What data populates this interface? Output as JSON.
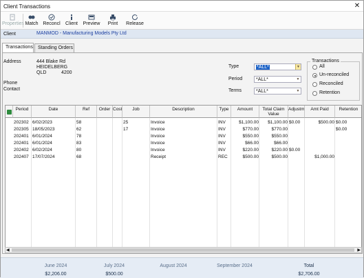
{
  "window": {
    "title": "Client Transactions",
    "close": "✕"
  },
  "toolbar": [
    {
      "label": "Properties",
      "icon": "properties-icon",
      "disabled": true
    },
    {
      "label": "Match",
      "icon": "match-icon",
      "disabled": false
    },
    {
      "label": "Reconcl",
      "icon": "reconcile-icon",
      "disabled": false
    },
    {
      "label": "Client",
      "icon": "client-info-icon",
      "disabled": false
    },
    {
      "label": "Preview",
      "icon": "preview-icon",
      "disabled": false
    },
    {
      "label": "Print",
      "icon": "print-icon",
      "disabled": false
    },
    {
      "label": "Release",
      "icon": "release-icon",
      "disabled": false
    }
  ],
  "client": {
    "label": "Client",
    "value": "MANMOD - Manufacturing Models Pty Ltd"
  },
  "tabs": [
    "Transactions",
    "Standing Orders"
  ],
  "address": {
    "label": "Address",
    "line1": "444 Blake Rd",
    "line2": "HEIDELBERG",
    "state": "QLD",
    "postcode": "4200"
  },
  "phone_label": "Phone",
  "contact_label": "Contact",
  "filters": {
    "type_label": "Type",
    "type_value": "*ALL*",
    "period_label": "Period",
    "period_value": "*ALL*",
    "terms_label": "Terms",
    "terms_value": "*ALL*"
  },
  "transactions_group": {
    "title": "Transactions",
    "options": [
      "All",
      "Un-reconciled",
      "Reconciled",
      "Retention"
    ],
    "selected": "Un-reconciled"
  },
  "table": {
    "headers": [
      "Period",
      "Date",
      "Ref",
      "Order",
      "Cost",
      "Job",
      "Description",
      "Type",
      "Amount",
      "Total Claim Value",
      "Adjustm",
      "Amt Paid",
      "Retention"
    ],
    "rows": [
      [
        "202302",
        "6/02/2023",
        "58",
        "",
        "",
        "25",
        "Invoice",
        "INV",
        "$1,100.00",
        "$1,100.00",
        "$0.00",
        "$500.00",
        "$0.00"
      ],
      [
        "202305",
        "18/05/2023",
        "62",
        "",
        "",
        "17",
        "Invoice",
        "INV",
        "$770.00",
        "$770.00",
        "",
        "",
        "$0.00"
      ],
      [
        "202401",
        "6/01/2024",
        "78",
        "",
        "",
        "",
        "Invoice",
        "INV",
        "$550.00",
        "$550.00",
        "",
        "",
        ""
      ],
      [
        "202401",
        "6/01/2024",
        "83",
        "",
        "",
        "",
        "Invoice",
        "INV",
        "$66.00",
        "$66.00",
        "",
        "",
        ""
      ],
      [
        "202402",
        "6/02/2024",
        "80",
        "",
        "",
        "",
        "Invoice",
        "INV",
        "$220.00",
        "$220.00",
        "$0.00",
        "",
        ""
      ],
      [
        "202407",
        "17/07/2024",
        "68",
        "",
        "",
        "",
        "Receipt",
        "REC",
        "$500.00",
        "$500.00",
        "",
        "$1,000.00",
        ""
      ]
    ]
  },
  "summary": {
    "headers": [
      "June 2024",
      "July 2024",
      "August 2024",
      "September 2024",
      "Total"
    ],
    "values": [
      "$2,206.00",
      "$500.00",
      "",
      "",
      "$2,706.00"
    ]
  }
}
